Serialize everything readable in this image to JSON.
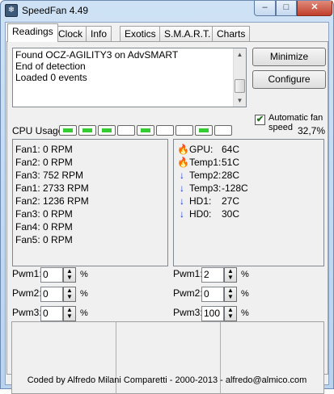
{
  "window": {
    "title": "SpeedFan 4.49",
    "icon": "speedfan-app-icon"
  },
  "title_buttons": {
    "minimize": "–",
    "maximize": "□",
    "close": "✕"
  },
  "tabs": [
    {
      "label": "Readings",
      "active": true
    },
    {
      "label": "Clock"
    },
    {
      "label": "Info"
    },
    {
      "label": "Exotics"
    },
    {
      "label": "S.M.A.R.T."
    },
    {
      "label": "Charts"
    }
  ],
  "log": {
    "lines": [
      "Found OCZ-AGILITY3 on AdvSMART",
      "End of detection",
      "Loaded 0 events"
    ]
  },
  "buttons": {
    "minimize": "Minimize",
    "configure": "Configure"
  },
  "auto_fan": {
    "label": "Automatic fan speed",
    "checked": true
  },
  "cpu": {
    "label": "CPU Usage",
    "percent": "32,7%",
    "cores": [
      true,
      true,
      true,
      false,
      true,
      false,
      false,
      true,
      false
    ]
  },
  "fans": [
    "Fan1: 0 RPM",
    "Fan2: 0 RPM",
    "Fan3: 752 RPM",
    "Fan1: 2733 RPM",
    "Fan2: 1236 RPM",
    "Fan3: 0 RPM",
    "Fan4: 0 RPM",
    "Fan5: 0 RPM"
  ],
  "temps": [
    {
      "name": "GPU:",
      "value": "64C",
      "icon": "flame-icon"
    },
    {
      "name": "Temp1:",
      "value": "51C",
      "icon": "flame-icon"
    },
    {
      "name": "Temp2:",
      "value": "28C",
      "icon": "down-arrow-icon"
    },
    {
      "name": "Temp3:",
      "value": "-128C",
      "icon": "down-arrow-icon"
    },
    {
      "name": "HD1:",
      "value": "27C",
      "icon": "down-arrow-icon"
    },
    {
      "name": "HD0:",
      "value": "30C",
      "icon": "down-arrow-icon"
    }
  ],
  "pwm_left": [
    {
      "label": "Pwm1:",
      "value": "0",
      "unit": "%"
    },
    {
      "label": "Pwm2:",
      "value": "0",
      "unit": "%"
    },
    {
      "label": "Pwm3:",
      "value": "0",
      "unit": "%"
    }
  ],
  "pwm_right": [
    {
      "label": "Pwm1:",
      "value": "2",
      "unit": "%"
    },
    {
      "label": "Pwm2:",
      "value": "0",
      "unit": "%"
    },
    {
      "label": "Pwm3:",
      "value": "100",
      "unit": "%"
    }
  ],
  "status": "Coded by Alfredo Milani Comparetti - 2000-2013 - alfredo@almico.com"
}
